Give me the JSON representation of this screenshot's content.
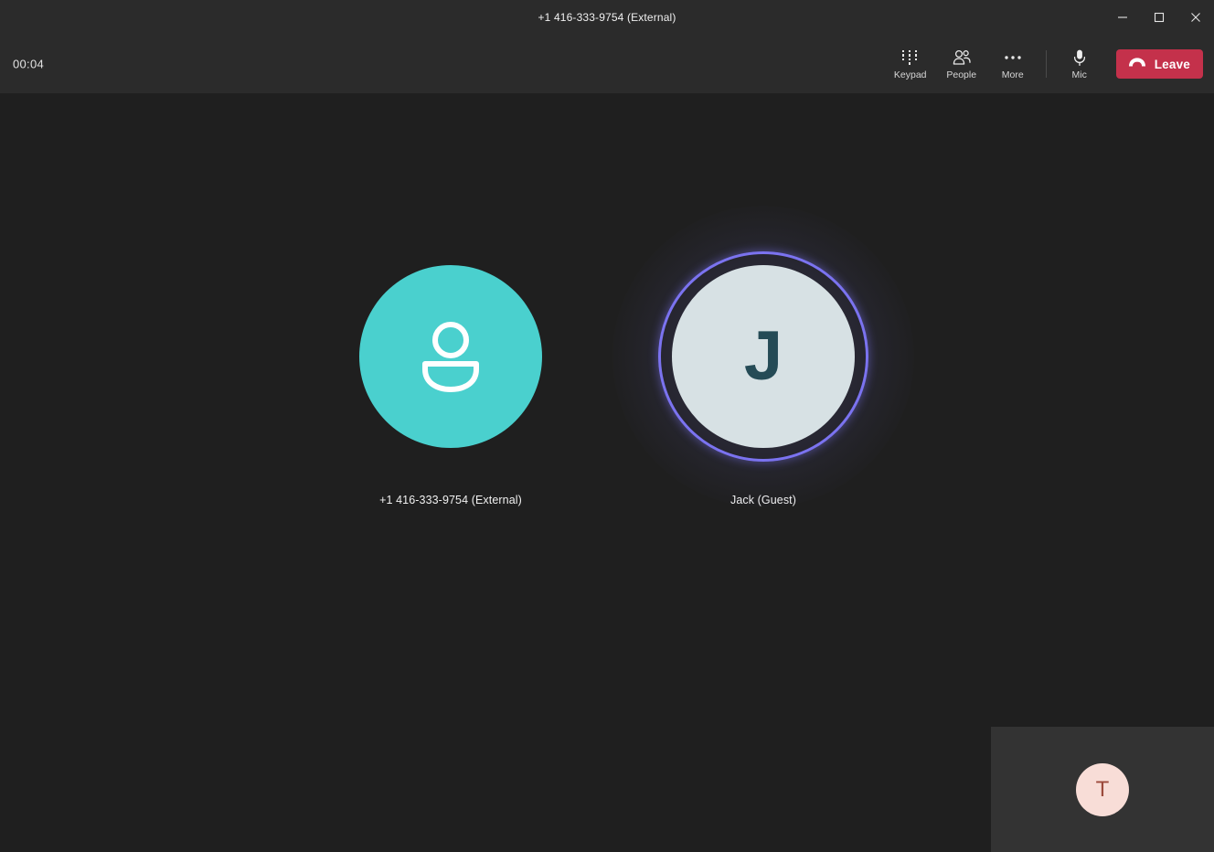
{
  "window": {
    "title": "+1 416-333-9754 (External)",
    "controls": [
      {
        "name": "minimize",
        "glyph": "minimize-icon",
        "tooltip": "Minimize"
      },
      {
        "name": "maximize",
        "glyph": "maximize-icon",
        "tooltip": "Maximize"
      },
      {
        "name": "close",
        "glyph": "close-icon",
        "tooltip": "Close"
      }
    ]
  },
  "toolbar": {
    "call_timer": "00:04",
    "actions": [
      {
        "id": "keypad",
        "label": "Keypad",
        "icon": "keypad-icon"
      },
      {
        "id": "people",
        "label": "People",
        "icon": "people-icon"
      },
      {
        "id": "more",
        "label": "More",
        "icon": "more-ellipsis-icon"
      },
      {
        "id": "mic",
        "label": "Mic",
        "icon": "microphone-icon"
      }
    ],
    "leave": {
      "label": "Leave",
      "icon": "hangup-phone-icon",
      "color": "#c4314b"
    }
  },
  "stage": {
    "participants": [
      {
        "id": "external-caller",
        "name": "+1 416-333-9754 (External)",
        "avatar_type": "person-icon",
        "avatar_color": "#4ad0ce",
        "speaking": false
      },
      {
        "id": "jack-guest",
        "name": "Jack (Guest)",
        "avatar_type": "initials",
        "initials": "J",
        "avatar_color": "#d7e1e4",
        "initials_color": "#254b56",
        "speaking": true,
        "speaking_ring_color": "#7b73f0"
      }
    ]
  },
  "selfview": {
    "initials": "T",
    "avatar_color": "#f8ddd7",
    "initials_color": "#9c4a3c",
    "background": "#333333"
  },
  "colors": {
    "app_background": "#1f1f1f",
    "chrome_background": "#2b2b2b",
    "accent_danger": "#c4314b",
    "speaking_accent": "#7b73f0"
  }
}
